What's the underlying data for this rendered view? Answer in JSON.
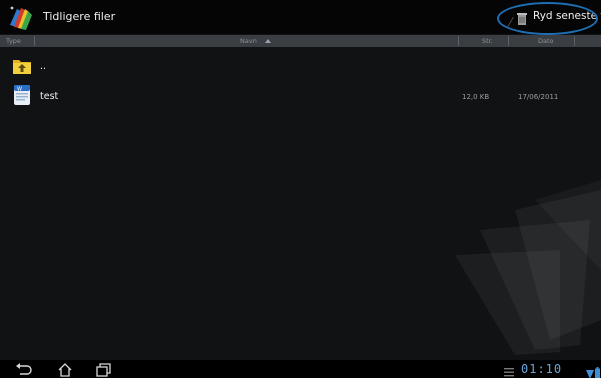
{
  "actionbar": {
    "title": "Tidligere filer",
    "clear_recent_label": "Ryd seneste filer"
  },
  "columns": {
    "type": "Type",
    "name": "Navn",
    "size": "Str.",
    "date": "Dato"
  },
  "rows": [
    {
      "name": "..",
      "size": "",
      "date": "",
      "icon": "parent-folder-icon"
    },
    {
      "name": "test",
      "size": "12,0 KB",
      "date": "17/06/2011",
      "icon": "word-document-icon"
    }
  ],
  "statusbar": {
    "clock": "01:10"
  },
  "colors": {
    "accent": "#1f6fb4",
    "clock": "#6aa6d8",
    "header": "#3a3d42"
  }
}
